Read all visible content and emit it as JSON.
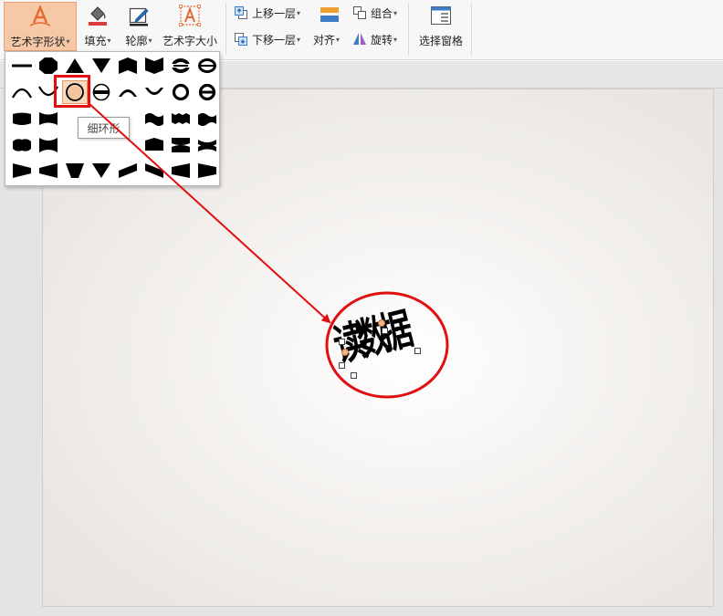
{
  "ribbon": {
    "wordart_shape": {
      "label": "艺术字形状",
      "icon": "wordart-shape-icon"
    },
    "fill": {
      "label": "填充",
      "icon": "fill-bucket-icon"
    },
    "outline": {
      "label": "轮廓",
      "icon": "outline-pen-icon"
    },
    "wordart_size": {
      "label": "艺术字大小",
      "icon": "wordart-size-icon"
    },
    "bring_forward": {
      "label": "上移一层",
      "icon": "bring-forward-icon"
    },
    "send_backward": {
      "label": "下移一层",
      "icon": "send-backward-icon"
    },
    "align_top_icon": "align-icon",
    "align": {
      "label": "对齐",
      "icon": "align-icon"
    },
    "group": {
      "label": "组合",
      "icon": "group-icon"
    },
    "rotate": {
      "label": "旋转",
      "icon": "rotate-icon"
    },
    "selection_pane": {
      "label": "选择窗格",
      "icon": "selection-pane-icon"
    }
  },
  "gallery": {
    "rows": 5,
    "columns": 8,
    "selected_shape": "thin-ring-shape",
    "tooltip": "细环形"
  },
  "slide": {
    "wordart_text": "读数据"
  },
  "colors": {
    "accent_orange": "#f6c8a8",
    "highlight_red": "#e01010",
    "ribbon_bg": "#f7f7f7"
  }
}
